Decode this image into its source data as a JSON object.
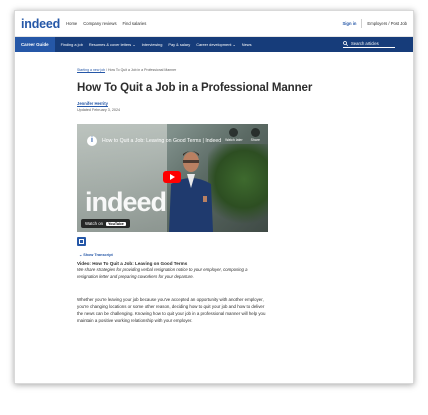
{
  "topnav": {
    "logo": "indeed",
    "links": [
      "Home",
      "Company reviews",
      "Find salaries"
    ],
    "sign_in": "Sign in",
    "employers": "Employers / Post Job"
  },
  "subnav": {
    "career_guide": "Career Guide",
    "links": [
      "Finding a job",
      "Resumes & cover letters ⌄",
      "Interviewing",
      "Pay & salary",
      "Career development ⌄",
      "News"
    ],
    "search_placeholder": "Search articles"
  },
  "article": {
    "breadcrumb_parent": "Starting a new job",
    "breadcrumb_sep": "/",
    "breadcrumb_current": "How To Quit a Job in a Professional Manner",
    "title": "How To Quit a Job in a Professional Manner",
    "author": "Jennifer Herrity",
    "updated": "Updated February 3, 2024",
    "video": {
      "title": "How to Quit a Job: Leaving on Good Terms | Indeed",
      "watch_later": "Watch later",
      "share": "Share",
      "overlay_word": "indeed",
      "watch_on": "Watch on",
      "youtube": "YouTube"
    },
    "show_transcript": "Show Transcript",
    "video_tag": "Video: How To Quit a Job: Leaving on Good Terms",
    "video_desc": "We share strategies for providing verbal resignation notice to your employer, composing a resignation letter and preparing coworkers for your departure.",
    "paragraph": "Whether you're leaving your job because you've accepted an opportunity with another employer, you're changing locations or some other reason, deciding how to quit your job and how to deliver the news can be challenging. Knowing how to quit your job in a professional manner will help you maintain a positive working relationship with your employer."
  },
  "colors": {
    "brand_blue": "#2557a7",
    "nav_dark": "#163c7a",
    "text": "#2d2d2d"
  }
}
